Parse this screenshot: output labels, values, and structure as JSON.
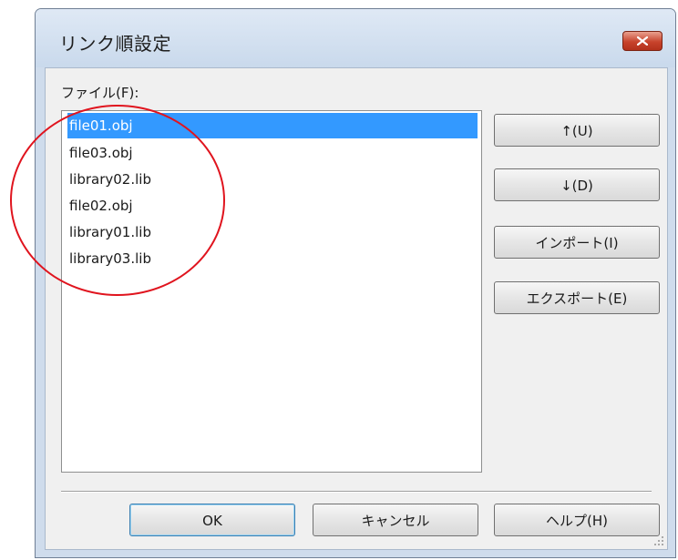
{
  "window": {
    "title": "リンク順設定",
    "close_icon": "close-icon",
    "close_color": "#c7432c"
  },
  "file_section": {
    "label": "ファイル(F):"
  },
  "file_list": {
    "selected_index": 0,
    "selection_color": "#3399ff",
    "items": [
      "file01.obj",
      "file03.obj",
      "library02.lib",
      "file02.obj",
      "library01.lib",
      "library03.lib"
    ]
  },
  "side_buttons": {
    "up": "↑(U)",
    "down": "↓(D)",
    "import": "インポート(I)",
    "export": "エクスポート(E)"
  },
  "footer_buttons": {
    "ok": "OK",
    "cancel": "キャンセル",
    "help": "ヘルプ(H)"
  },
  "annotation_color": "#e0141e"
}
